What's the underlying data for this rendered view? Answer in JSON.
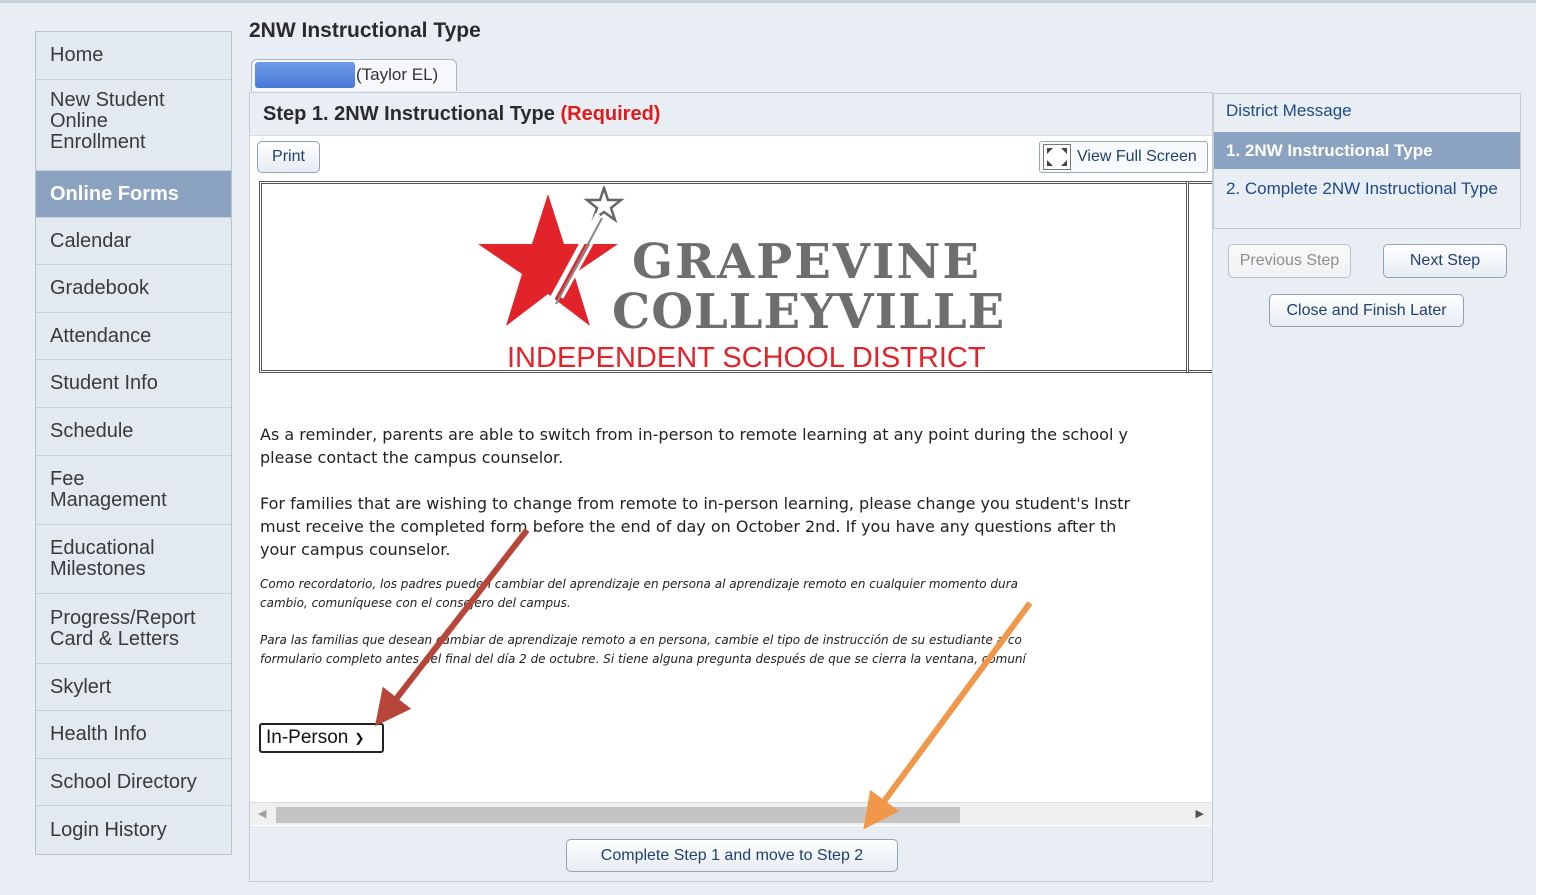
{
  "page": {
    "title": "2NW Instructional Type"
  },
  "student_tab": {
    "campus": "(Taylor EL)"
  },
  "nav": {
    "items": [
      {
        "label": "Home",
        "active": false
      },
      {
        "label": "New Student Online Enrollment",
        "active": false
      },
      {
        "label": "Online Forms",
        "active": true
      },
      {
        "label": "Calendar",
        "active": false
      },
      {
        "label": "Gradebook",
        "active": false
      },
      {
        "label": "Attendance",
        "active": false
      },
      {
        "label": "Student Info",
        "active": false
      },
      {
        "label": "Schedule",
        "active": false
      },
      {
        "label": "Fee Management",
        "active": false
      },
      {
        "label": "Educational Milestones",
        "active": false
      },
      {
        "label": "Progress/Report Card & Letters",
        "active": false
      },
      {
        "label": "Skylert",
        "active": false
      },
      {
        "label": "Health Info",
        "active": false
      },
      {
        "label": "School Directory",
        "active": false
      },
      {
        "label": "Login History",
        "active": false
      }
    ]
  },
  "step": {
    "title": "Step 1. 2NW Instructional Type",
    "required": "(Required)",
    "print_label": "Print",
    "fullscreen_label": "View Full Screen"
  },
  "logo": {
    "line1": "GRAPEVINE",
    "line2": "COLLEYVILLE",
    "line3": "INDEPENDENT SCHOOL DISTRICT"
  },
  "content": {
    "en_p1_l1": "As a reminder, parents are able to switch from in-person to remote learning at any point during the school y",
    "en_p1_l2": "please contact the campus counselor.",
    "en_p2_l1": "For families that are wishing to change from remote to in-person learning, please change you student's Instr",
    "en_p2_l2": "must receive the completed form before the end of day on October 2nd. If you have any questions after th",
    "en_p2_l3": "your campus counselor.",
    "es_p1_l1": "Como recordatorio, los padres pueden cambiar del aprendizaje en persona al aprendizaje remoto en cualquier momento dura",
    "es_p1_l2": "cambio, comuníquese con el consejero del campus.",
    "es_p2_l1": "Para las familias que desean cambiar de aprendizaje remoto a en persona, cambie el tipo de instrucción de su estudiante a co",
    "es_p2_l2": "formulario completo antes del final del día 2 de octubre. Si tiene alguna pregunta después de que se cierra la ventana, comuní"
  },
  "instruction_select": {
    "value": "In-Person"
  },
  "complete_button": {
    "label": "Complete Step 1 and move to Step 2"
  },
  "steps_panel": {
    "items": [
      {
        "label": "District Message",
        "active": false
      },
      {
        "label": "1. 2NW Instructional Type",
        "active": true
      },
      {
        "label": "2. Complete 2NW Instructional Type",
        "active": false
      }
    ],
    "previous_label": "Previous Step",
    "next_label": "Next Step",
    "close_label": "Close and Finish Later"
  },
  "colors": {
    "nav_active": "#8ba3c0",
    "required_red": "#e01b1b",
    "logo_red": "#e2232a",
    "arrow_red": "#b8453a",
    "arrow_orange": "#f0974a"
  }
}
